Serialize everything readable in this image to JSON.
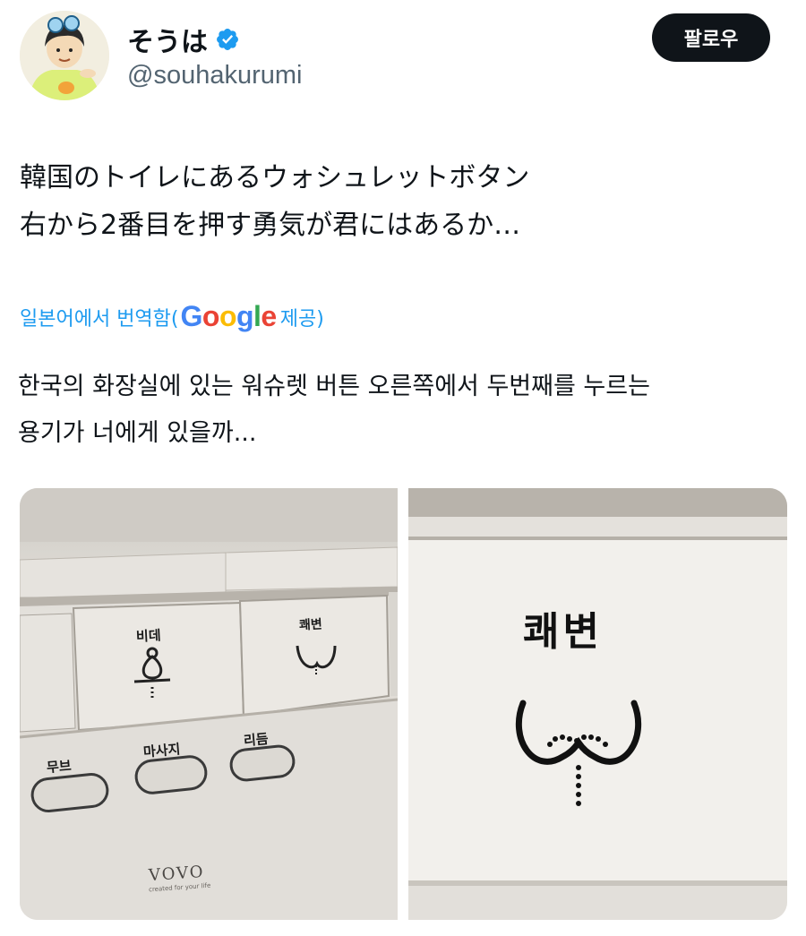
{
  "author": {
    "display_name": "そうは",
    "handle": "@souhakurumi",
    "verified_icon": "verified-badge-icon",
    "badge_color": "#1d9bf0"
  },
  "follow_label": "팔로우",
  "tweet": {
    "text": "韓国のトイレにあるウォシュレットボタン\n右から2番目を押す勇気が君にはあるか…"
  },
  "translation": {
    "prefix": "일본어에서 번역함(",
    "google_word": "Google",
    "suffix": " 제공)",
    "text": "한국의 화장실에 있는 워슈렛 버튼 오른쪽에서 두번째를 누르는\n용기가 너에게 있을까..."
  },
  "media": {
    "left_photo": {
      "label_bidet": "비데",
      "label_stool": "쾌변",
      "label_move": "무브",
      "label_massage": "마사지",
      "label_rhythm": "리듬",
      "brand": "VOVO",
      "brand_tagline": "created for your life"
    },
    "right_photo": {
      "label_stool": "쾌변"
    }
  }
}
